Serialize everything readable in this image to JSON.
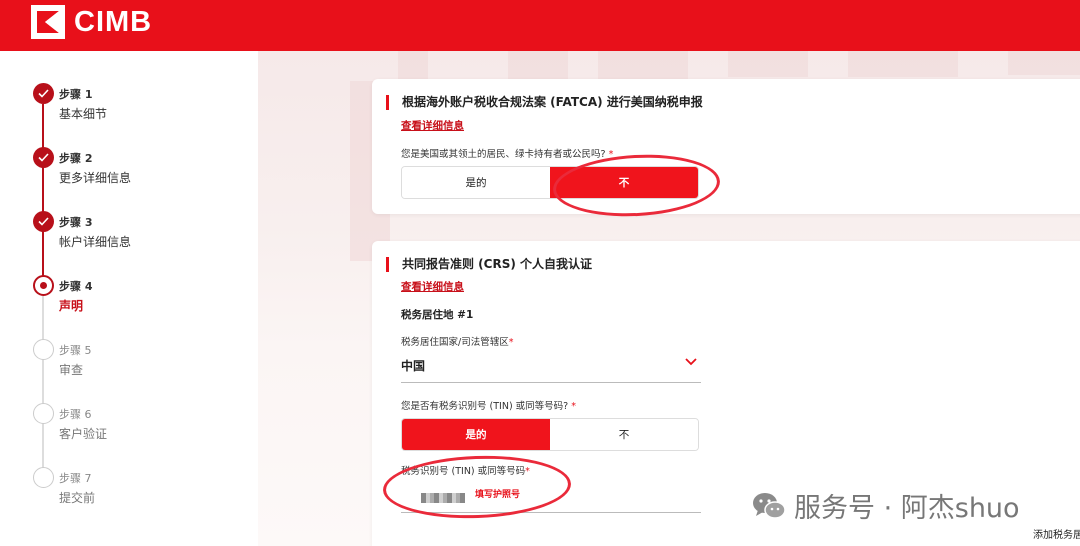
{
  "brand": {
    "name": "CIMB"
  },
  "steps": [
    {
      "num": "步骤 1",
      "name": "基本细节",
      "state": "done"
    },
    {
      "num": "步骤 2",
      "name": "更多详细信息",
      "state": "done"
    },
    {
      "num": "步骤 3",
      "name": "帐户详细信息",
      "state": "done"
    },
    {
      "num": "步骤 4",
      "name": "声明",
      "state": "current"
    },
    {
      "num": "步骤 5",
      "name": "审查",
      "state": "todo"
    },
    {
      "num": "步骤 6",
      "name": "客户验证",
      "state": "todo"
    },
    {
      "num": "步骤 7",
      "name": "提交前",
      "state": "todo"
    }
  ],
  "fatca": {
    "title": "根据海外账户税收合规法案 (FATCA) 进行美国纳税申报",
    "link": "查看详细信息",
    "question": "您是美国或其领土的居民、绿卡持有者或公民吗?",
    "required": "*",
    "yes": "是的",
    "no": "不",
    "selected": "no"
  },
  "crs": {
    "title": "共同报告准则 (CRS) 个人自我认证",
    "link": "查看详细信息",
    "residence_heading": "税务居住地 #1",
    "country_label": "税务居住国家/司法管辖区",
    "country_value": "中国",
    "tin_question": "您是否有税务识别号 (TIN) 或同等号码?",
    "yes": "是的",
    "no": "不",
    "selected": "yes",
    "tin_label": "税务识别号 (TIN) 或同等号码",
    "tin_hint": "填写护照号",
    "required": "*"
  },
  "footer": {
    "add_text": "添加税务居"
  },
  "watermark": {
    "text": "服务号 · 阿杰shuo"
  },
  "colors": {
    "brand": "#e8101a",
    "accent": "#c8101a",
    "annotation": "#ea2a3a"
  }
}
